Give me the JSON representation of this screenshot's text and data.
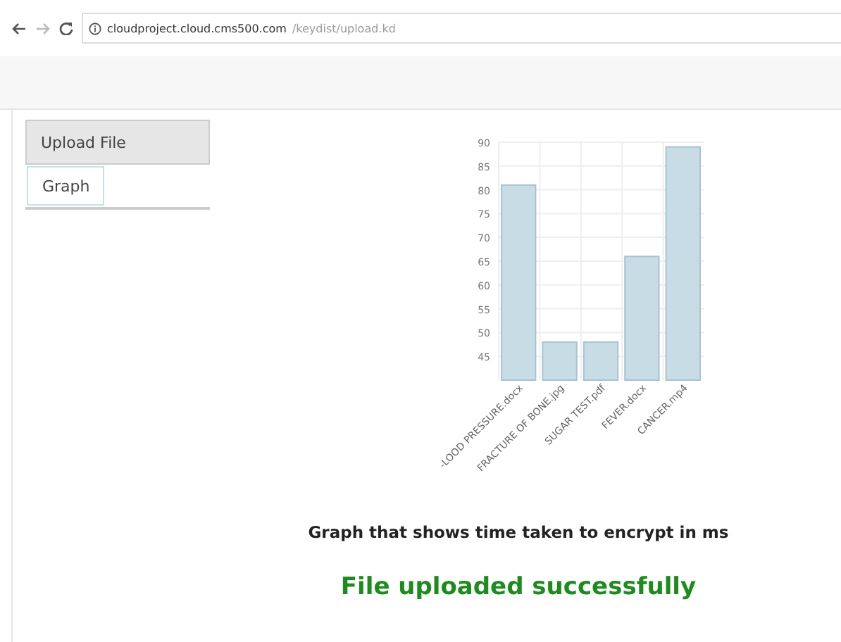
{
  "browser": {
    "url_host": "cloudproject.cloud.cms500.com",
    "url_path": "/keydist/upload.kd"
  },
  "tabs": [
    {
      "label": "Upload File",
      "selected": false
    },
    {
      "label": "Graph",
      "selected": true
    }
  ],
  "graph": {
    "chart_data": {
      "type": "bar",
      "categories": [
        "-LOOD PRESSURE.docx",
        "FRACTURE OF BONE.jpg",
        "SUGAR TEST.pdf",
        "FEVER.docx",
        "CANCER.mp4"
      ],
      "values": [
        81,
        48,
        48,
        66,
        89
      ],
      "ylim": [
        40,
        90
      ],
      "yticks": [
        45,
        50,
        55,
        60,
        65,
        70,
        75,
        80,
        85,
        90
      ],
      "grid": true
    },
    "caption": "Graph that shows time taken to encrypt in ms"
  },
  "message": "File uploaded successfully"
}
